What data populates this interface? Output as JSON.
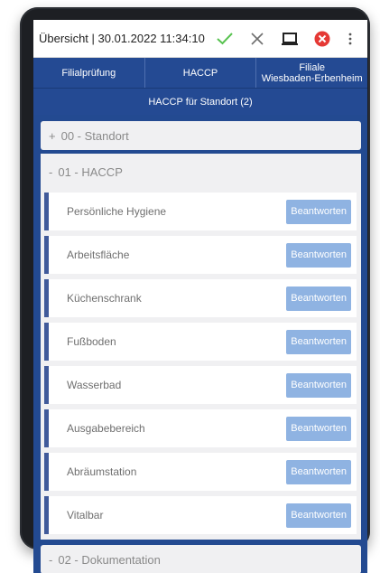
{
  "topbar": {
    "title": "Übersicht | 30.01.2022 11:34:10",
    "icons": [
      "check-icon",
      "close-icon",
      "laptop-icon",
      "error-circle-icon",
      "more-vertical-icon"
    ],
    "colors": {
      "check": "#57c24f",
      "close": "#6f6f6f",
      "error": "#e53935"
    }
  },
  "tabs": [
    {
      "label": "Filialprüfung"
    },
    {
      "label": "HACCP"
    },
    {
      "label_line1": "Filiale",
      "label_line2": "Wiesbaden-Erbenheim"
    }
  ],
  "subheader": "HACCP für Standort (2)",
  "sections": [
    {
      "prefix": "+",
      "label": "00 - Standort"
    },
    {
      "prefix": "-",
      "label": "01 - HACCP"
    },
    {
      "prefix": "-",
      "label": "02 - Dokumentation"
    }
  ],
  "haccp_items": [
    {
      "label": "Persönliche Hygiene",
      "action": "Beantworten"
    },
    {
      "label": "Arbeitsfläche",
      "action": "Beantworten"
    },
    {
      "label": "Küchenschrank",
      "action": "Beantworten"
    },
    {
      "label": "Fußboden",
      "action": "Beantworten"
    },
    {
      "label": "Wasserbad",
      "action": "Beantworten"
    },
    {
      "label": "Ausgabebereich",
      "action": "Beantworten"
    },
    {
      "label": "Abräumstation",
      "action": "Beantworten"
    },
    {
      "label": "Vitalbar",
      "action": "Beantworten"
    }
  ],
  "colors": {
    "primary": "#244a93",
    "button": "#8fb3e2",
    "row_accent": "#405a9a",
    "section_bg": "#f0f0f2"
  }
}
